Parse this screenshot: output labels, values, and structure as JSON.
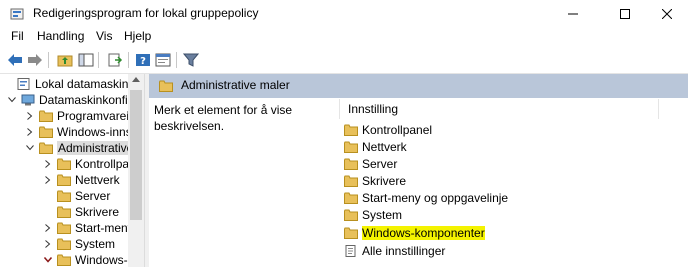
{
  "window": {
    "title": "Redigeringsprogram for lokal gruppepolicy"
  },
  "menu": [
    "Fil",
    "Handling",
    "Vis",
    "Hjelp"
  ],
  "tree": {
    "items": [
      {
        "label": "Lokal datamaskin-po",
        "expander": "",
        "icon": "policy-icon"
      },
      {
        "label": "Datamaskinkonfig",
        "expander": "expanded",
        "icon": "computer-icon"
      },
      {
        "label": "Programvarei",
        "expander": "collapsed",
        "icon": "folder-icon"
      },
      {
        "label": "Windows-inns",
        "expander": "collapsed",
        "icon": "folder-icon"
      },
      {
        "label": "Administrative",
        "expander": "expanded",
        "icon": "folder-icon",
        "selected": true
      },
      {
        "label": "Kontrollpa",
        "expander": "collapsed",
        "icon": "folder-icon"
      },
      {
        "label": "Nettverk",
        "expander": "collapsed",
        "icon": "folder-icon"
      },
      {
        "label": "Server",
        "expander": "",
        "icon": "folder-icon"
      },
      {
        "label": "Skrivere",
        "expander": "",
        "icon": "folder-icon"
      },
      {
        "label": "Start-meny",
        "expander": "collapsed",
        "icon": "folder-icon"
      },
      {
        "label": "System",
        "expander": "collapsed",
        "icon": "folder-icon"
      },
      {
        "label": "Windows-",
        "expander": "expanded",
        "icon": "folder-icon"
      }
    ]
  },
  "right": {
    "header": "Administrative maler",
    "description": "Merk et element for å vise beskrivelsen.",
    "column": "Innstilling",
    "items": [
      {
        "label": "Kontrollpanel",
        "icon": "folder-icon"
      },
      {
        "label": "Nettverk",
        "icon": "folder-icon"
      },
      {
        "label": "Server",
        "icon": "folder-icon"
      },
      {
        "label": "Skrivere",
        "icon": "folder-icon"
      },
      {
        "label": "Start-meny og oppgavelinje",
        "icon": "folder-icon"
      },
      {
        "label": "System",
        "icon": "folder-icon"
      },
      {
        "label": "Windows-komponenter",
        "icon": "folder-icon",
        "highlight": true
      },
      {
        "label": "Alle innstillinger",
        "icon": "settings-list-icon"
      }
    ]
  },
  "colors": {
    "header_bg": "#b9c6d9",
    "highlight": "#f4f300",
    "folder": "#e8c05a"
  }
}
